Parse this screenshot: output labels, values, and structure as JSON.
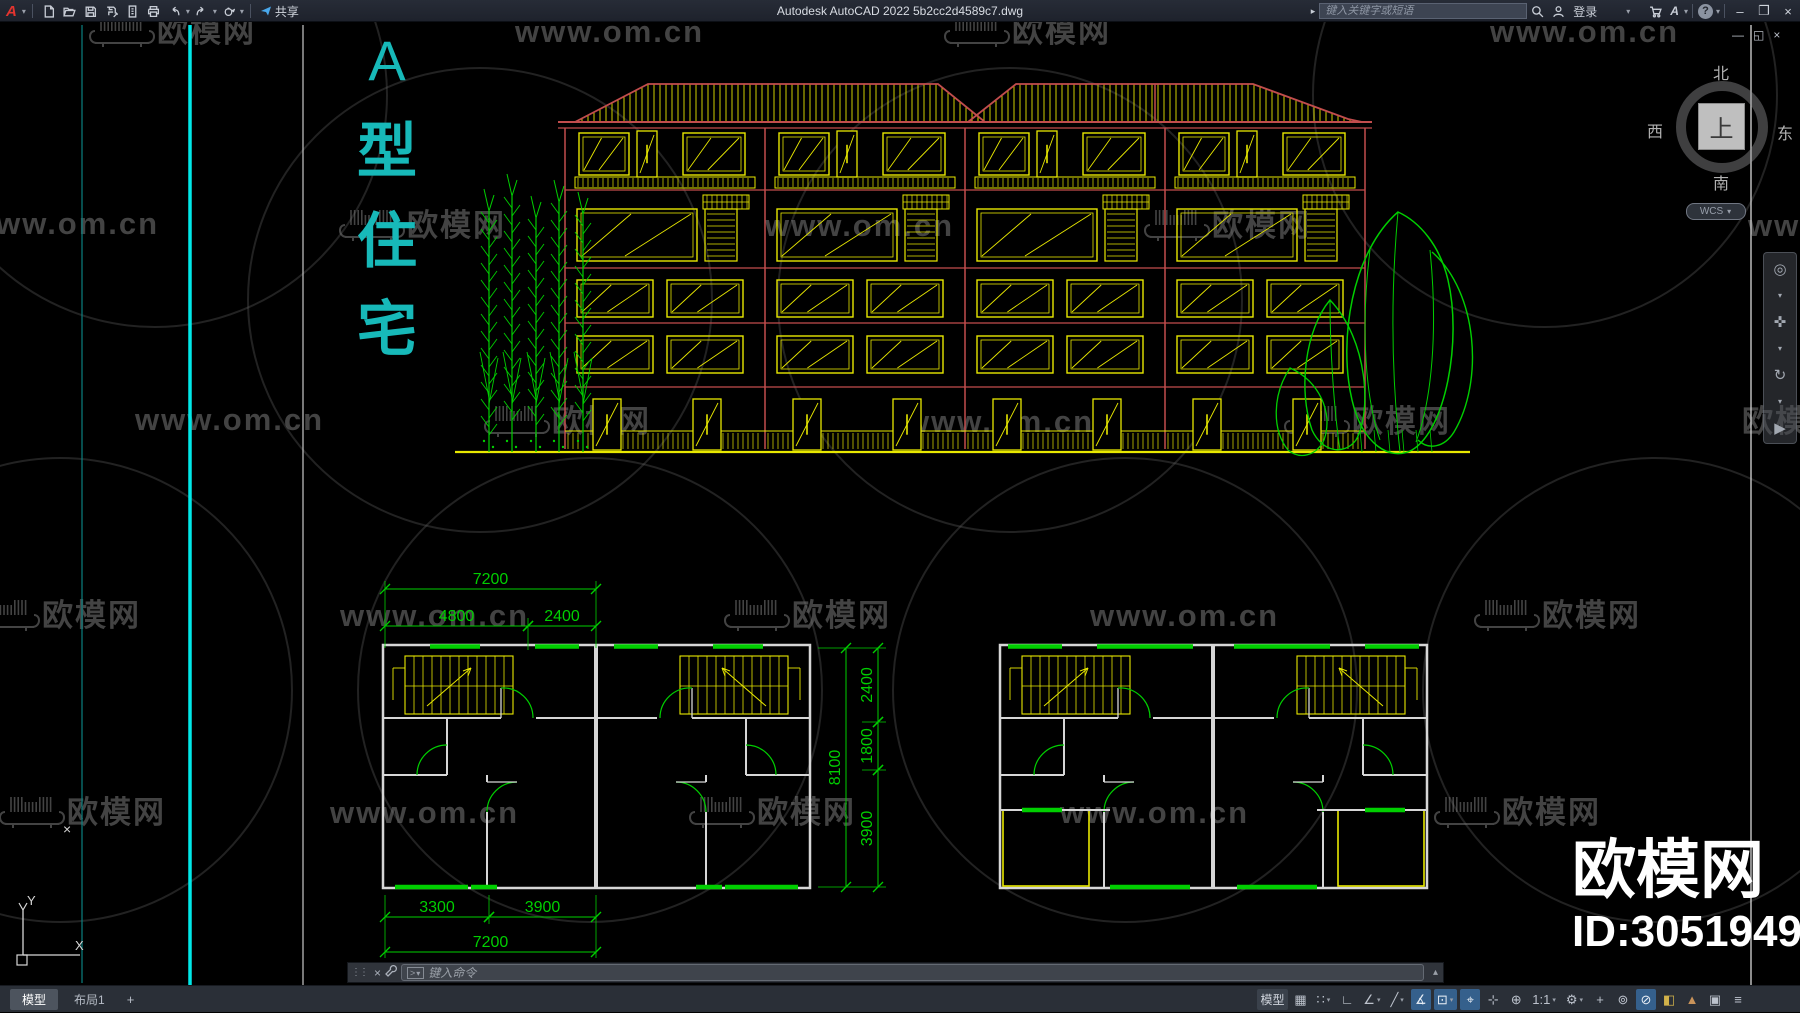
{
  "titlebar": {
    "app_logo": "A",
    "window_title": "Autodesk AutoCAD 2022    5b2cc2d4589c7.dwg",
    "quick_access": [
      {
        "name": "new-file"
      },
      {
        "name": "open-folder"
      },
      {
        "name": "save"
      },
      {
        "name": "save-as"
      },
      {
        "name": "sheet-set"
      },
      {
        "name": "plot"
      },
      {
        "name": "undo",
        "dropdown": true
      },
      {
        "name": "redo",
        "dropdown": true
      },
      {
        "name": "render",
        "dropdown": true
      }
    ],
    "share_label": "共享",
    "infocenter": {
      "search_placeholder": "键入关键字或短语",
      "login_label": "登录",
      "help_label": "?"
    },
    "window_controls": {
      "minimize": "–",
      "maximize": "❐",
      "close": "×"
    }
  },
  "canvas_window_controls": {
    "minimize": "—",
    "restore": "◱",
    "close": "×"
  },
  "viewcube": {
    "north": "北",
    "south": "南",
    "west": "西",
    "east": "东",
    "top": "上",
    "wcs_label": "WCS"
  },
  "navbar_tools": [
    {
      "name": "steering-wheel",
      "glyph": "◎"
    },
    {
      "name": "pan",
      "glyph": "✜"
    },
    {
      "name": "orbit",
      "glyph": "↻"
    },
    {
      "name": "show-motion",
      "glyph": "▶"
    }
  ],
  "annotation": {
    "chars": [
      "A",
      "型",
      "住",
      "宅"
    ]
  },
  "dimensions": {
    "plan_top_total": "7200",
    "plan_top_a": "4800",
    "plan_top_b": "2400",
    "plan_bottom_a": "3300",
    "plan_bottom_b": "3900",
    "plan_bottom_total": "7200",
    "plan_side_a": "2400",
    "plan_side_b": "1800",
    "plan_side_c": "3900",
    "plan_side_total": "8100"
  },
  "watermarks": {
    "url": "www.om.cn",
    "brand": "欧模网",
    "big_brand": "欧模网",
    "big_id": "ID:3051949"
  },
  "command_line": {
    "placeholder": "键入命令"
  },
  "layout_tabs": [
    {
      "label": "模型",
      "active": true
    },
    {
      "label": "布局1",
      "active": false
    },
    {
      "label": "+",
      "active": false
    }
  ],
  "statusbar": {
    "toggles": [
      {
        "name": "model-space",
        "text": "模型"
      },
      {
        "name": "grid-display",
        "glyph": "▦"
      },
      {
        "name": "snap-mode",
        "glyph": "∷",
        "dropdown": true
      },
      {
        "name": "ortho-mode",
        "glyph": "∟"
      },
      {
        "name": "polar-tracking",
        "glyph": "∠",
        "dropdown": true
      },
      {
        "name": "isometric-drafting",
        "glyph": "╱",
        "dropdown": true
      },
      {
        "name": "object-snap-tracking",
        "glyph": "∡",
        "active": true
      },
      {
        "name": "object-snap",
        "glyph": "⊡",
        "active": true,
        "dropdown": true
      },
      {
        "name": "dynamic-input",
        "glyph": "⌖",
        "active": true
      },
      {
        "name": "annotation-visibility",
        "glyph": "⊹"
      },
      {
        "name": "annotation-autoscale",
        "glyph": "⊕"
      },
      {
        "name": "annotation-scale",
        "text2": "1:1",
        "dropdown": true
      },
      {
        "name": "workspace-switching",
        "glyph": "⚙",
        "dropdown": true
      },
      {
        "name": "annotation-monitor",
        "glyph": "+"
      },
      {
        "name": "units",
        "glyph": "⊚"
      },
      {
        "name": "graphics-performance",
        "glyph": "⊘",
        "active": true
      },
      {
        "name": "isolate-objects",
        "glyph": "◧",
        "color": "#d2b24a"
      },
      {
        "name": "clean-screen-mountain",
        "glyph": "▲",
        "color": "#c9935a"
      },
      {
        "name": "clean-screen",
        "glyph": "▣"
      },
      {
        "name": "customization",
        "glyph": "≡"
      }
    ]
  }
}
